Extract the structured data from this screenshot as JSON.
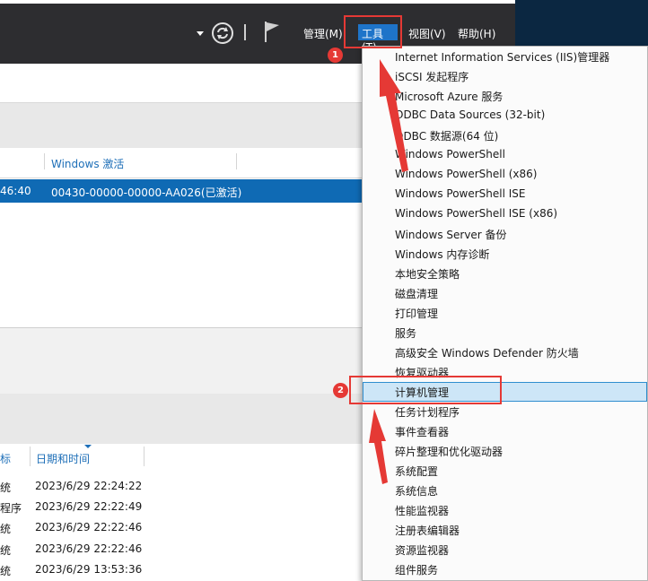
{
  "menubar": {
    "items": [
      {
        "label": "管理(M)"
      },
      {
        "label": "工具(T)"
      },
      {
        "label": "视图(V)"
      },
      {
        "label": "帮助(H)"
      }
    ]
  },
  "properties_table": {
    "column_header": "Windows 激活",
    "selected_row": {
      "time_partial": "46:40",
      "activation": "00430-00000-00000-AA026(已激活)"
    }
  },
  "events_table": {
    "column_header_source_partial": "标",
    "column_header_datetime": "日期和时间",
    "rows": [
      {
        "source": "统",
        "datetime": "2023/6/29 22:24:22"
      },
      {
        "source": "程序",
        "datetime": "2023/6/29 22:22:49"
      },
      {
        "source": "统",
        "datetime": "2023/6/29 22:22:46"
      },
      {
        "source": "统",
        "datetime": "2023/6/29 22:22:46"
      },
      {
        "source": "统",
        "datetime": "2023/6/29 13:53:36"
      }
    ]
  },
  "tools_menu": {
    "items": [
      {
        "label": "Internet Information Services (IIS)管理器"
      },
      {
        "label": "iSCSI 发起程序"
      },
      {
        "label": "Microsoft Azure 服务"
      },
      {
        "label": "ODBC Data Sources (32-bit)"
      },
      {
        "label": "ODBC 数据源(64 位)"
      },
      {
        "label": "Windows PowerShell"
      },
      {
        "label": "Windows PowerShell (x86)"
      },
      {
        "label": "Windows PowerShell ISE"
      },
      {
        "label": "Windows PowerShell ISE (x86)"
      },
      {
        "label": "Windows Server 备份"
      },
      {
        "label": "Windows 内存诊断"
      },
      {
        "label": "本地安全策略"
      },
      {
        "label": "磁盘清理"
      },
      {
        "label": "打印管理"
      },
      {
        "label": "服务"
      },
      {
        "label": "高级安全 Windows Defender 防火墙"
      },
      {
        "label": "恢复驱动器"
      },
      {
        "label": "计算机管理"
      },
      {
        "label": "任务计划程序"
      },
      {
        "label": "事件查看器"
      },
      {
        "label": "碎片整理和优化驱动器"
      },
      {
        "label": "系统配置"
      },
      {
        "label": "系统信息"
      },
      {
        "label": "性能监视器"
      },
      {
        "label": "注册表编辑器"
      },
      {
        "label": "资源监视器"
      },
      {
        "label": "组件服务"
      }
    ],
    "highlighted_item": "计算机管理"
  },
  "annotations": {
    "badge1": "1",
    "badge2": "2"
  },
  "colors": {
    "titlebar": "#2d2d30",
    "accent": "#1e74c9",
    "selected_row": "#0f6ab4",
    "annotation_red": "#e53935",
    "menu_highlight": "#cde6f7"
  },
  "icons": [
    "dropdown-arrow-icon",
    "refresh-icon",
    "flag-icon"
  ]
}
